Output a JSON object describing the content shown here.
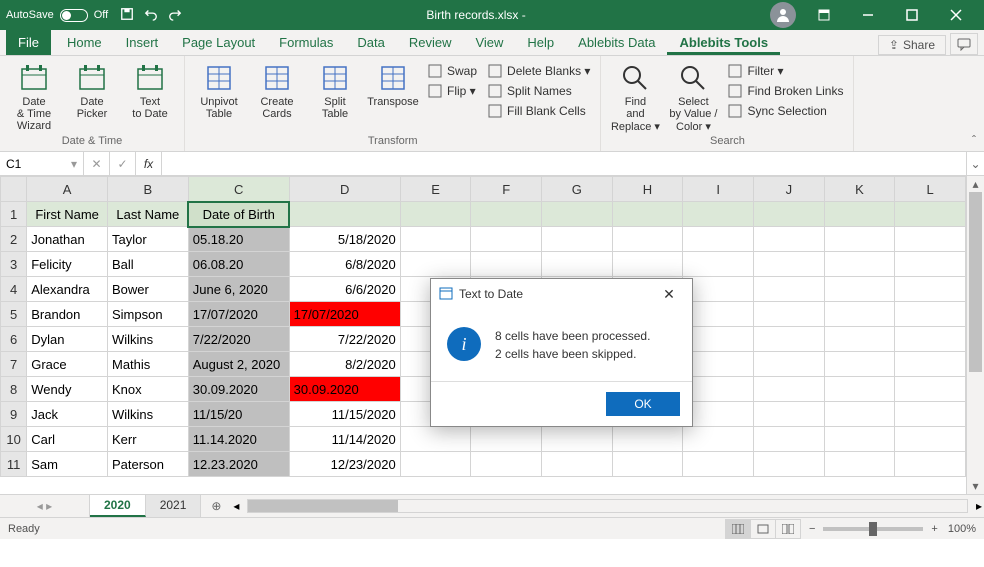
{
  "titlebar": {
    "autosave_label": "AutoSave",
    "autosave_state": "Off",
    "filename": "Birth records.xlsx  -"
  },
  "tabs": {
    "file": "File",
    "items": [
      "Home",
      "Insert",
      "Page Layout",
      "Formulas",
      "Data",
      "Review",
      "View",
      "Help",
      "Ablebits Data",
      "Ablebits Tools"
    ],
    "active_index": 9,
    "share": "Share"
  },
  "ribbon": {
    "groups": [
      {
        "label": "Date & Time",
        "big": [
          {
            "label": "Date & Time Wizard"
          },
          {
            "label": "Date Picker"
          },
          {
            "label": "Text to Date"
          }
        ]
      },
      {
        "label": "Transform",
        "big": [
          {
            "label": "Unpivot Table"
          },
          {
            "label": "Create Cards"
          },
          {
            "label": "Split Table"
          },
          {
            "label": "Transpose"
          }
        ],
        "small": [
          {
            "label": "Swap"
          },
          {
            "label": "Flip ▾"
          }
        ],
        "small2": [
          {
            "label": "Delete Blanks ▾"
          },
          {
            "label": "Split Names"
          },
          {
            "label": "Fill Blank Cells"
          }
        ]
      },
      {
        "label": "Search",
        "big": [
          {
            "label": "Find and Replace ▾"
          },
          {
            "label": "Select by Value / Color ▾"
          }
        ],
        "small": [
          {
            "label": "Filter ▾"
          },
          {
            "label": "Find Broken Links"
          },
          {
            "label": "Sync Selection"
          }
        ]
      }
    ]
  },
  "formula_bar": {
    "namebox": "C1",
    "fx_label": "fx",
    "value": ""
  },
  "columns": [
    "A",
    "B",
    "C",
    "D",
    "E",
    "F",
    "G",
    "H",
    "I",
    "J",
    "K",
    "L"
  ],
  "headers": [
    "First Name",
    "Last Name",
    "Date of Birth"
  ],
  "rows": [
    {
      "n": 2,
      "a": "Jonathan",
      "b": "Taylor",
      "c": "05.18.20",
      "d": "5/18/2020"
    },
    {
      "n": 3,
      "a": "Felicity",
      "b": "Ball",
      "c": "06.08.20",
      "d": "6/8/2020"
    },
    {
      "n": 4,
      "a": "Alexandra",
      "b": "Bower",
      "c": "June 6, 2020",
      "d": "6/6/2020"
    },
    {
      "n": 5,
      "a": "Brandon",
      "b": "Simpson",
      "c": "17/07/2020",
      "d": "17/07/2020",
      "red": true
    },
    {
      "n": 6,
      "a": "Dylan",
      "b": "Wilkins",
      "c": "7/22/2020",
      "d": "7/22/2020"
    },
    {
      "n": 7,
      "a": "Grace",
      "b": "Mathis",
      "c": "August 2, 2020",
      "d": "8/2/2020"
    },
    {
      "n": 8,
      "a": "Wendy",
      "b": "Knox",
      "c": "30.09.2020",
      "d": "30.09.2020",
      "red": true
    },
    {
      "n": 9,
      "a": "Jack",
      "b": "Wilkins",
      "c": "11/15/20",
      "d": "11/15/2020"
    },
    {
      "n": 10,
      "a": "Carl",
      "b": "Kerr",
      "c": "11.14.2020",
      "d": "11/14/2020"
    },
    {
      "n": 11,
      "a": "Sam",
      "b": "Paterson",
      "c": "12.23.2020",
      "d": "12/23/2020"
    }
  ],
  "sheet_tabs": {
    "active": "2020",
    "other": "2021"
  },
  "status": {
    "ready": "Ready",
    "zoom": "100%"
  },
  "dialog": {
    "title": "Text to Date",
    "line1": "8 cells have been processed.",
    "line2": "2 cells have been skipped.",
    "ok": "OK"
  }
}
